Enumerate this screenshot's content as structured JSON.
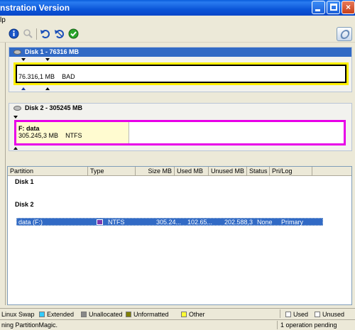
{
  "window": {
    "title": "nstration Version",
    "controls": {
      "minimize": "minimize",
      "maximize": "maximize",
      "close": "×"
    }
  },
  "menubar": {
    "items": [
      "lp"
    ]
  },
  "toolbar": {
    "icons": [
      "info-icon",
      "search-icon",
      "undo-icon",
      "discard-icon",
      "apply-icon"
    ]
  },
  "disks": [
    {
      "header": "Disk 1 - 76316 MB",
      "partition": {
        "size": "76.316,1 MB",
        "status": "BAD"
      }
    },
    {
      "header": "Disk 2 - 305245 MB",
      "partition": {
        "label": "F:  data",
        "size": "305.245,3 MB",
        "fs": "NTFS"
      }
    }
  ],
  "table": {
    "columns": [
      "Partition",
      "Type",
      "Size MB",
      "Used MB",
      "Unused MB",
      "Status",
      "Pri/Log"
    ],
    "groups": [
      "Disk 1",
      "Disk 2"
    ],
    "rows": [
      {
        "partition": "data (F:)",
        "type": "NTFS",
        "size": "305.24...",
        "used": "102.65...",
        "unused": "202.588,3",
        "status": "None",
        "prilog": "Primary"
      }
    ]
  },
  "legend": {
    "items": [
      {
        "label": "Linux Swap",
        "color": ""
      },
      {
        "label": "Extended",
        "color": "#33ccff"
      },
      {
        "label": "Unallocated",
        "color": "#888888"
      },
      {
        "label": "Unformatted",
        "color": "#808000"
      },
      {
        "label": "Other",
        "color": "#ffff33"
      }
    ],
    "used": "Used",
    "unused": "Unused"
  },
  "status": {
    "left": "ning PartitionMagic.",
    "right": "1 operation pending"
  }
}
